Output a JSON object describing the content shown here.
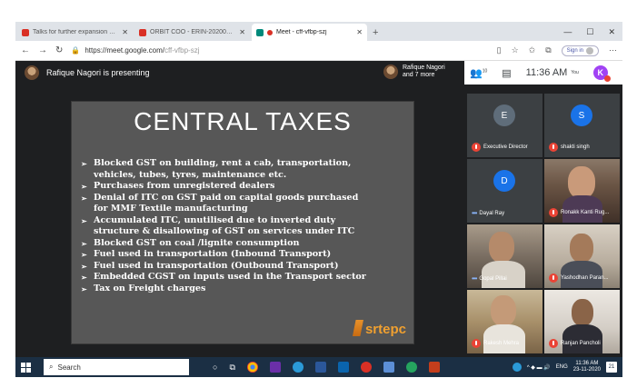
{
  "browser": {
    "tabs": [
      {
        "title": "Talks for further expansion of ...",
        "favicon_color": "#d93025",
        "active": false
      },
      {
        "title": "ORBIT COO - ERIN-2020010...",
        "favicon_color": "#d93025",
        "active": false
      },
      {
        "title": "Meet - cff-vfbp-szj",
        "favicon_color": "#00897b",
        "active": true
      }
    ],
    "new_tab_glyph": "+",
    "url_prefix": "https://meet.google.com/",
    "url_path": "cff-vfbp-szj",
    "sign_in_label": "Sign in"
  },
  "meet": {
    "presenter_text": "Rafique Nagori is presenting",
    "others_line1": "Rafique Nagori",
    "others_line2": "and 7 more",
    "participant_count": "10",
    "time": "11:36 AM",
    "you_label": "You",
    "self_initial": "K",
    "accent_color": "#a142f4"
  },
  "slide": {
    "title": "CENTRAL TAXES",
    "bullets": [
      {
        "line1": "Blocked GST on building, rent a cab, transportation,",
        "line2": "vehicles, tubes, tyres, maintenance etc."
      },
      {
        "line1": "Purchases from unregistered dealers",
        "line2": ""
      },
      {
        "line1": "Denial of ITC on GST paid on capital goods purchased",
        "line2": "for MMF Textile manufacturing"
      },
      {
        "line1": "Accumulated ITC, unutilised due to inverted duty",
        "line2": "structure & disallowing of GST on services under ITC"
      },
      {
        "line1": "Blocked GST on coal /lignite consumption",
        "line2": ""
      },
      {
        "line1": "Fuel used in transportation (Inbound Transport)",
        "line2": ""
      },
      {
        "line1": "Fuel used in transportation (Outbound Transport)",
        "line2": ""
      },
      {
        "line1": "Embedded CGST on inputs used in the Transport sector",
        "line2": ""
      },
      {
        "line1": "Tax on Freight charges",
        "line2": ""
      }
    ],
    "logo_text": "srtepc"
  },
  "participants": [
    {
      "name": "Executive Director",
      "initial": "E",
      "color": "#5f6d7a",
      "muted": true,
      "kind": "initial"
    },
    {
      "name": "shakti singh",
      "initial": "S",
      "color": "#1a73e8",
      "muted": true,
      "kind": "initial"
    },
    {
      "name": "Dayal Ray",
      "initial": "D",
      "color": "#1a73e8",
      "muted": false,
      "kind": "initial"
    },
    {
      "name": "Ronakk Kanti Rug...",
      "initial": "",
      "color": "",
      "muted": true,
      "kind": "photo"
    },
    {
      "name": "Gopal Pillai",
      "initial": "",
      "color": "",
      "muted": false,
      "kind": "photo"
    },
    {
      "name": "Yashodhan Paran...",
      "initial": "",
      "color": "",
      "muted": true,
      "kind": "photo"
    },
    {
      "name": "Rakesh Mehra",
      "initial": "",
      "color": "",
      "muted": true,
      "kind": "photo"
    },
    {
      "name": "Ranjan Pancholi",
      "initial": "",
      "color": "",
      "muted": true,
      "kind": "photo"
    }
  ],
  "taskbar": {
    "search_placeholder": "Search",
    "clock_time": "11:36 AM",
    "clock_date": "23-11-2020",
    "lang": "ENG",
    "notification_count": "21"
  }
}
